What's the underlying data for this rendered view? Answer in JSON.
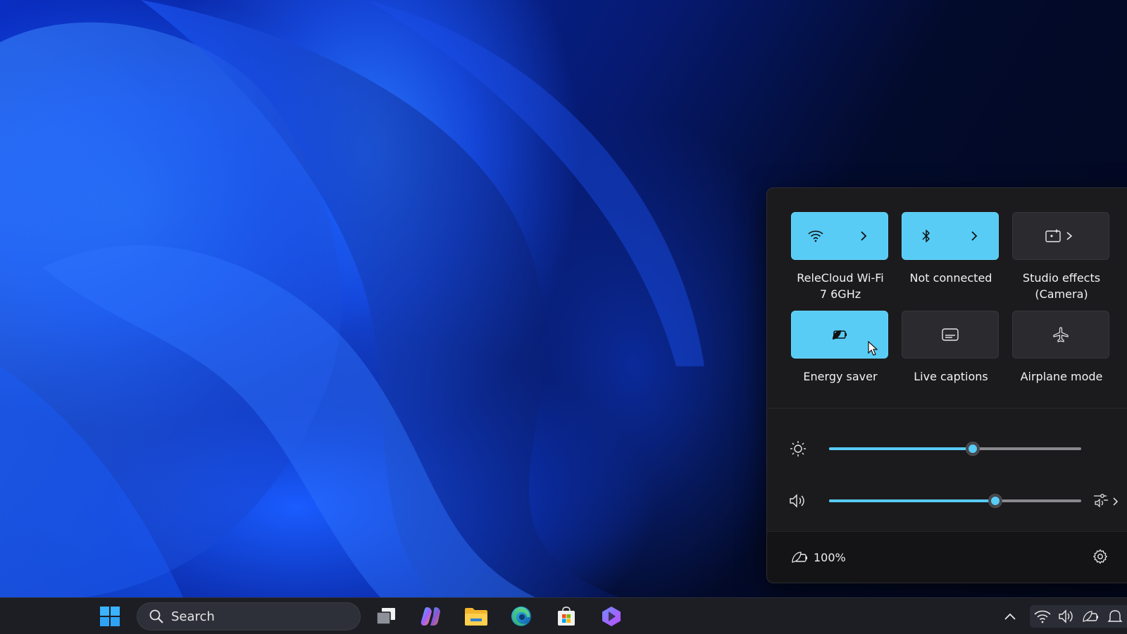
{
  "quick_settings": {
    "tiles": [
      {
        "id": "wifi",
        "label_line1": "ReleCloud Wi-Fi",
        "label_line2": "7 6GHz",
        "state": "on",
        "icon": "wifi-icon",
        "has_chevron": true
      },
      {
        "id": "bluetooth",
        "label_line1": "Not connected",
        "label_line2": "",
        "state": "on",
        "icon": "bluetooth-icon",
        "has_chevron": true
      },
      {
        "id": "studio",
        "label_line1": "Studio effects",
        "label_line2": "(Camera)",
        "state": "off",
        "icon": "studio-effects-icon",
        "has_chevron": true
      },
      {
        "id": "energy",
        "label_line1": "Energy saver",
        "label_line2": "",
        "state": "on",
        "icon": "energy-saver-icon",
        "has_chevron": false
      },
      {
        "id": "captions",
        "label_line1": "Live captions",
        "label_line2": "",
        "state": "off",
        "icon": "live-captions-icon",
        "has_chevron": false
      },
      {
        "id": "airplane",
        "label_line1": "Airplane mode",
        "label_line2": "",
        "state": "off",
        "icon": "airplane-icon",
        "has_chevron": false
      }
    ],
    "brightness": {
      "icon": "brightness-icon",
      "level": 0.57
    },
    "volume": {
      "icon": "speaker-icon",
      "level": 0.66,
      "extra_icon": "audio-output-icon"
    },
    "battery": {
      "icon": "battery-leaf-icon",
      "percent": "100%"
    },
    "settings_icon": "gear-icon"
  },
  "taskbar": {
    "search_placeholder": "Search",
    "apps": [
      "start-icon",
      "task-view-icon",
      "copilot-icon",
      "file-explorer-icon",
      "edge-icon",
      "store-icon",
      "app-icon"
    ],
    "tray": [
      "chevron-up-icon",
      "wifi-icon",
      "speaker-icon",
      "battery-leaf-icon",
      "notification-icon"
    ]
  },
  "colors": {
    "accent": "#58ccf5",
    "panel": "#1b1b1d",
    "tile_off": "#2b2b2f",
    "taskbar": "#1c1e24"
  }
}
